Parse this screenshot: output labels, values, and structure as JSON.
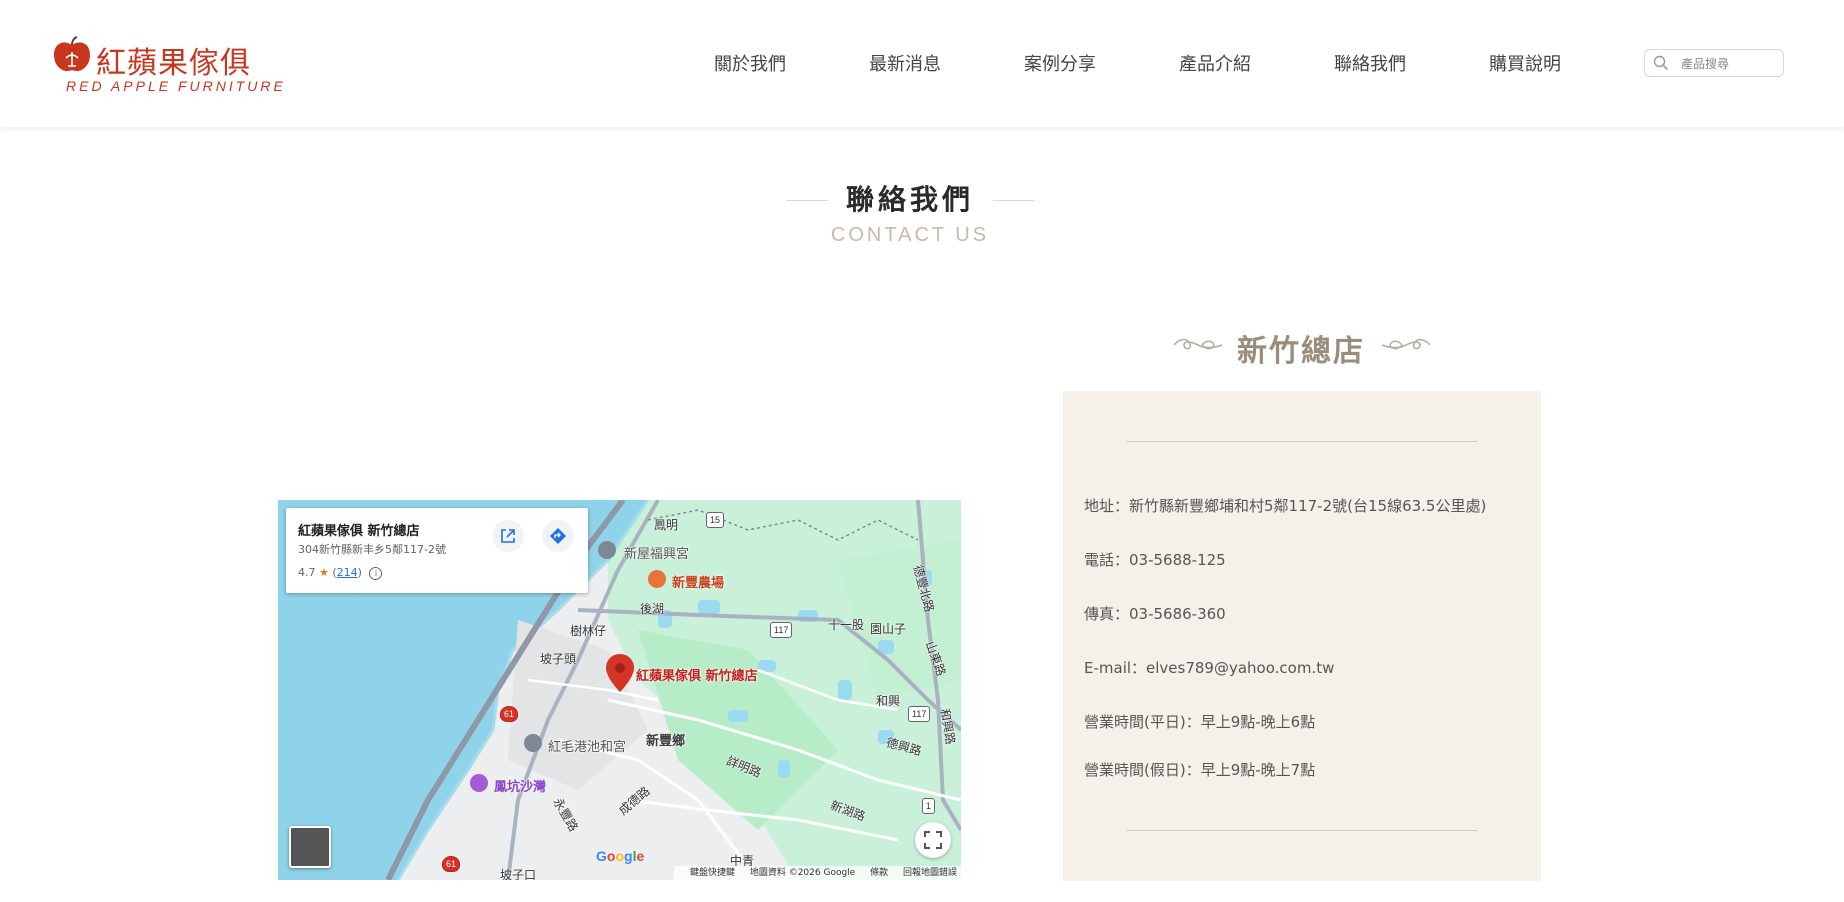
{
  "header": {
    "logo_cn": "紅蘋果傢俱",
    "logo_en": "RED  APPLE  FURNITURE",
    "nav": [
      "關於我們",
      "最新消息",
      "案例分享",
      "產品介紹",
      "聯絡我們",
      "購買說明"
    ],
    "search_placeholder": "產品搜尋"
  },
  "section": {
    "title": "聯絡我們",
    "subtitle": "CONTACT US"
  },
  "map": {
    "place_name": "紅蘋果傢俱 新竹總店",
    "place_address": "304新竹縣新丰乡5鄰117-2號",
    "rating": "4.7",
    "review_count": "214",
    "pin_label": "紅蘋果傢俱 新竹總店",
    "labels": {
      "fengming": "鳳明",
      "xinwu_temple": "新屋福興宮",
      "xinfeng_farm": "新豐農場",
      "houhu": "後湖",
      "shulinzi": "樹林仔",
      "pozitou": "坡子頭",
      "shiyigu": "十一股",
      "yuanshanzi": "園山子",
      "hexing": "和興",
      "hongmao_temple": "紅毛港池和宮",
      "xinfeng_township": "新豐鄉",
      "fengkeng_beach": "鳳坑沙灣",
      "xiangtian": "詳明路",
      "chengde": "成德路",
      "yongfeng": "永豐路",
      "xinhu": "新湖路",
      "deming": "德興路",
      "zhongxing": "中青",
      "potou": "坡子口",
      "shanqi": "山東路",
      "defeng": "德豐北路",
      "hexing_rd": "和興路"
    },
    "shields": [
      "15",
      "117",
      "117",
      "61",
      "61",
      "1"
    ],
    "google": "Google",
    "footer": [
      "鍵盤快捷鍵",
      "地圖資料 ©2026 Google",
      "條款",
      "回報地圖錯誤"
    ]
  },
  "store": {
    "name": "新竹總店",
    "address": "地址：新竹縣新豐鄉埔和村5鄰117-2號(台15線63.5公里處)",
    "phone": "電話：03-5688-125",
    "fax": "傳真：03-5686-360",
    "email": "E-mail：elves789@yahoo.com.tw",
    "hours_weekday": "營業時間(平日)：早上9點-晚上6點",
    "hours_holiday": "營業時間(假日)：早上9點-晚上7點"
  }
}
